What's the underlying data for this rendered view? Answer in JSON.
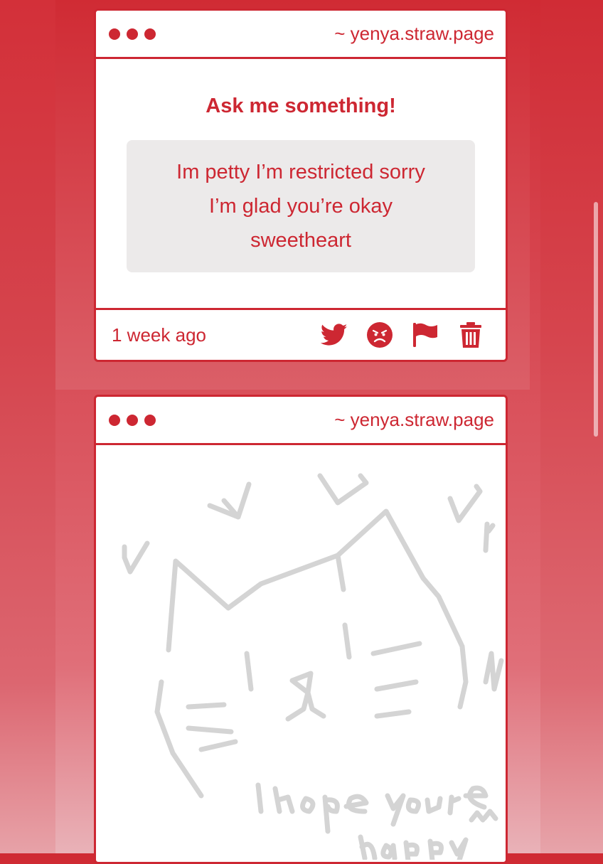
{
  "post1": {
    "site": "~ yenya.straw.page",
    "title": "Ask me something!",
    "answer_lines": [
      "Im petty I’m restricted sorry",
      "I’m glad you’re okay",
      "sweetheart"
    ],
    "timestamp": "1 week ago",
    "actions": [
      "twitter-icon",
      "angry-face-icon",
      "flag-icon",
      "trash-icon"
    ]
  },
  "post2": {
    "site": "~ yenya.straw.page",
    "drawing": {
      "subject": "cat-face-with-hearts-icon",
      "handwritten_lines": [
        "I hope you're",
        "happy ^^"
      ]
    }
  },
  "colors": {
    "accent": "#cd2732",
    "answer_bg": "#eceaea",
    "sketch": "#d4d4d4"
  }
}
